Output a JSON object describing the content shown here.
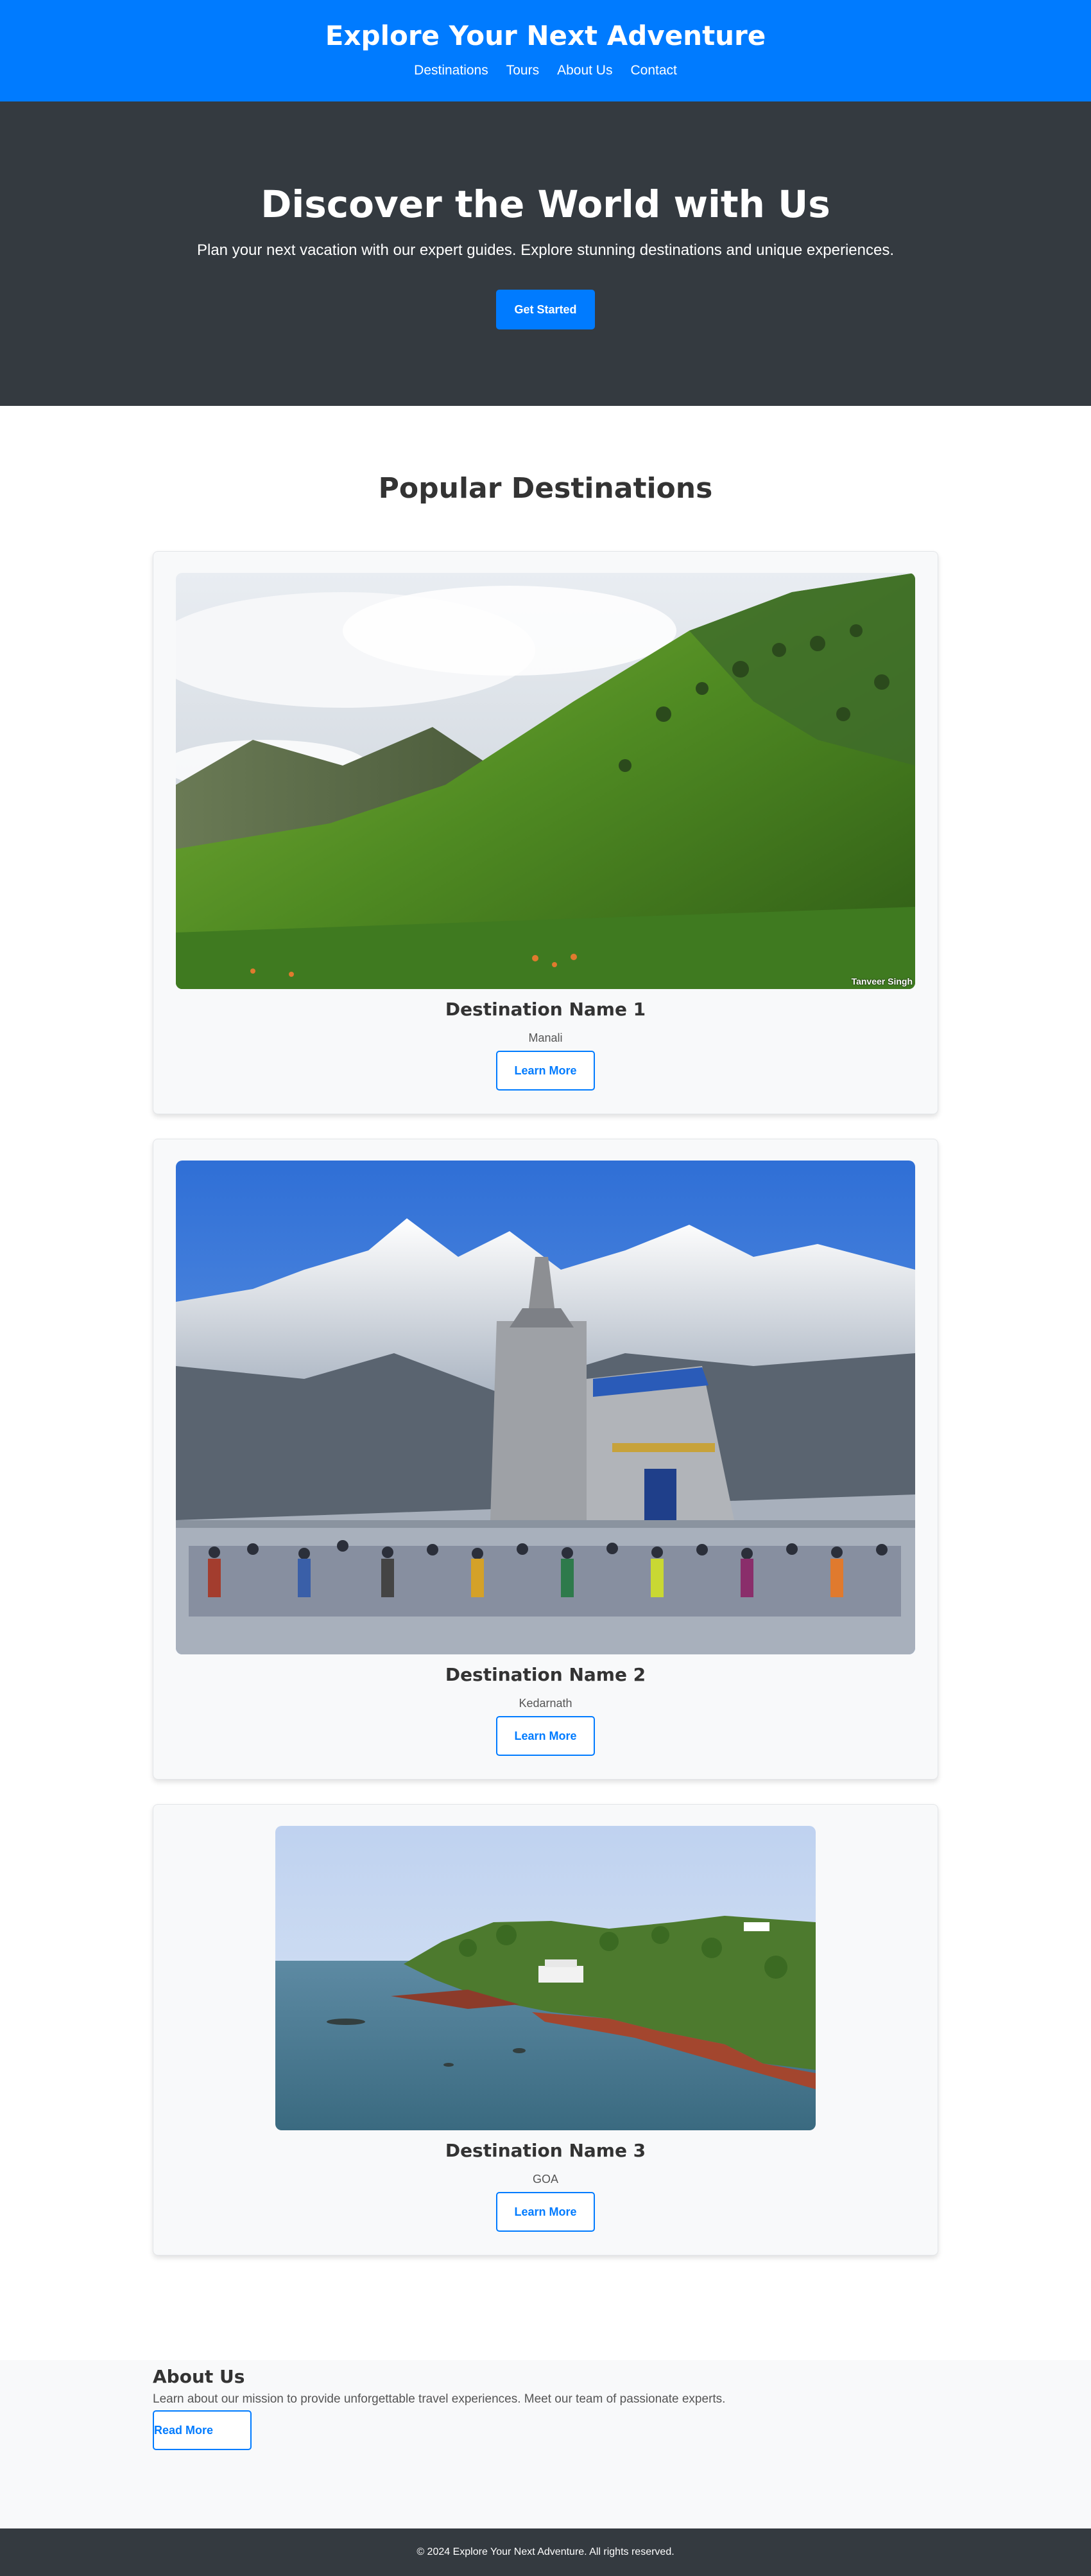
{
  "header": {
    "title": "Explore Your Next Adventure",
    "nav": [
      "Destinations",
      "Tours",
      "About Us",
      "Contact"
    ]
  },
  "hero": {
    "title": "Discover the World with Us",
    "subtitle": "Plan your next vacation with our expert guides. Explore stunning destinations and unique experiences.",
    "cta_label": "Get Started"
  },
  "destinations": {
    "title": "Popular Destinations",
    "cards": [
      {
        "name": "Destination Name 1",
        "location": "Manali",
        "button": "Learn More",
        "image_label": "Tanveer Singh"
      },
      {
        "name": "Destination Name 2",
        "location": "Kedarnath",
        "button": "Learn More"
      },
      {
        "name": "Destination Name 3",
        "location": "GOA",
        "button": "Learn More"
      }
    ]
  },
  "about": {
    "title": "About Us",
    "text": "Learn about our mission to provide unforgettable travel experiences. Meet our team of passionate experts.",
    "button": "Read More"
  },
  "footer": {
    "text": "© 2024 Explore Your Next Adventure. All rights reserved."
  },
  "colors": {
    "primary": "#007bff",
    "dark": "#343a40",
    "light": "#f8f9fa"
  }
}
